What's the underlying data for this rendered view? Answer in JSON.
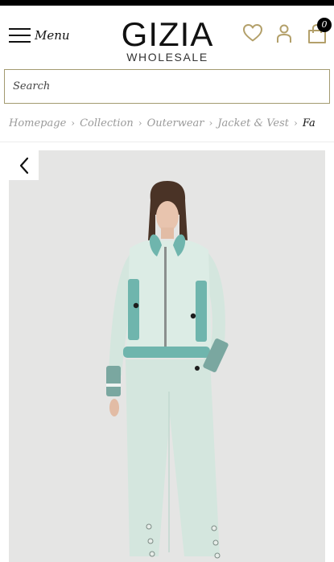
{
  "header": {
    "menu_label": "Menu",
    "logo_main": "GIZIA",
    "logo_sub": "WHOLESALE",
    "cart_count": "0"
  },
  "search": {
    "placeholder": "Search"
  },
  "breadcrumb": {
    "items": [
      "Homepage",
      "Collection",
      "Outerwear",
      "Jacket & Vest",
      "Fa"
    ]
  },
  "icons": {
    "menu": "hamburger-icon",
    "wishlist": "heart-icon",
    "account": "user-icon",
    "cart": "shopping-bag-icon",
    "back": "chevron-left-icon"
  },
  "colors": {
    "search_border": "#a39a70",
    "gallery_bg": "#e5e5e4",
    "garment": "#d4e6de",
    "fur_trim": "#6fb5ad"
  }
}
